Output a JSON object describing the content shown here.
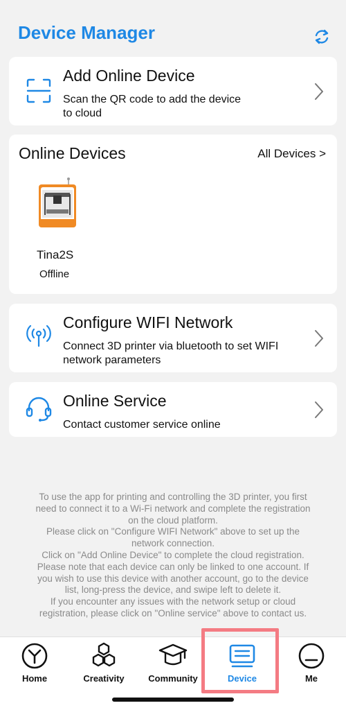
{
  "header": {
    "title": "Device Manager",
    "refresh_icon": "refresh-icon"
  },
  "add_device": {
    "title": "Add Online Device",
    "desc_line1": "Scan the QR code to add the device",
    "desc_line2": "to  cloud",
    "icon": "qr-scan-icon"
  },
  "online_devices": {
    "title": "Online Devices",
    "all_link": "All Devices >",
    "devices": [
      {
        "name": "Tina2S",
        "status": "Offline"
      }
    ]
  },
  "configure_wifi": {
    "title": "Configure WIFI Network",
    "desc_line1": "Connect 3D printer via bluetooth to set WIFI",
    "desc_line2": "network parameters",
    "icon": "wifi-signal-icon"
  },
  "online_service": {
    "title": "Online Service",
    "desc_line1": "Contact customer service online",
    "icon": "headset-icon"
  },
  "info_text": [
    "To use the app for printing and controlling the 3D printer, you first",
    "need to connect it to a Wi-Fi network and complete the registration",
    "on the cloud platform.",
    "Please click on \"Configure WIFI Network\" above to set up the",
    "network connection.",
    "Click on \"Add Online Device\" to complete the cloud registration.",
    "Please note that each device can only be linked to one account. If",
    "you wish to use this device with another account, go to the device",
    "list, long-press the device, and swipe left to delete it.",
    "If you encounter any issues with the network setup or cloud",
    "registration, please click on \"Online service\" above to contact us."
  ],
  "tabs": [
    {
      "label": "Home",
      "icon": "home-tab-icon"
    },
    {
      "label": "Creativity",
      "icon": "hexagons-icon"
    },
    {
      "label": "Community",
      "icon": "graduation-cap-icon"
    },
    {
      "label": "Device",
      "icon": "device-list-icon",
      "active": true
    },
    {
      "label": "Me",
      "icon": "profile-icon"
    }
  ],
  "colors": {
    "accent": "#1e88e5",
    "background": "#f2f2f2",
    "highlight": "#f47b83"
  }
}
